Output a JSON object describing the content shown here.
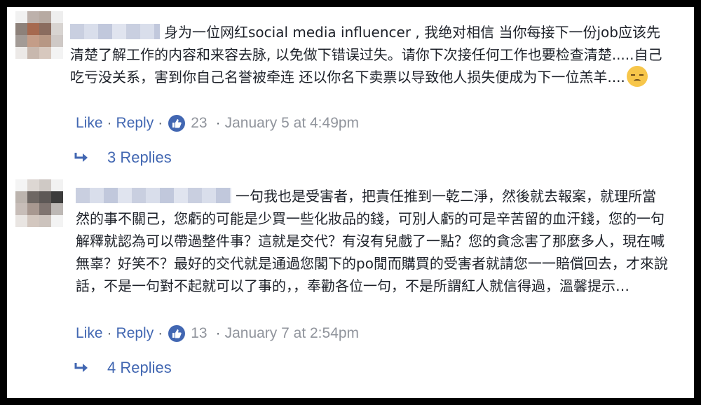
{
  "comments": [
    {
      "text": "身为一位网红social media influencer , 我绝对相信 当你每接下一份job应该先清楚了解工作的内容和来容去脉, 以免做下错误过失。请你下次接任何工作也要检查清楚.....自己吃亏没关系，害到你自己名誉被牵连 还以你名下卖票以导致他人损失便成为下一位羔羊....",
      "like_label": "Like",
      "reply_label": "Reply",
      "separator": "·",
      "reaction_count": "23",
      "timestamp": "January 5 at 4:49pm",
      "replies_label": "3 Replies",
      "emoji": "pensive-face-icon"
    },
    {
      "text": "一句我也是受害者，把責任推到一乾二淨，然後就去報案，就理所當然的事不關己，您虧的可能是少買一些化妝品的錢，可別人虧的可是辛苦留的血汗錢，您的一句解釋就認為可以帶過整件事？這就是交代？有沒有兒戲了一點？您的貪念害了那麼多人，現在喊無辜？好笑不？最好的交代就是通過您閣下的po閒而購買的受害者就請您一一賠償回去，才來說話，不是一句對不起就可以了事的，，奉勸各位一句，不是所謂紅人就信得過，溫馨提示…",
      "like_label": "Like",
      "reply_label": "Reply",
      "separator": "·",
      "reaction_count": "13",
      "timestamp": "January 7 at 2:54pm",
      "replies_label": "4 Replies"
    }
  ],
  "colors": {
    "link": "#4267b2",
    "meta": "#90949c",
    "text": "#1d2129",
    "frame": "#000000"
  }
}
